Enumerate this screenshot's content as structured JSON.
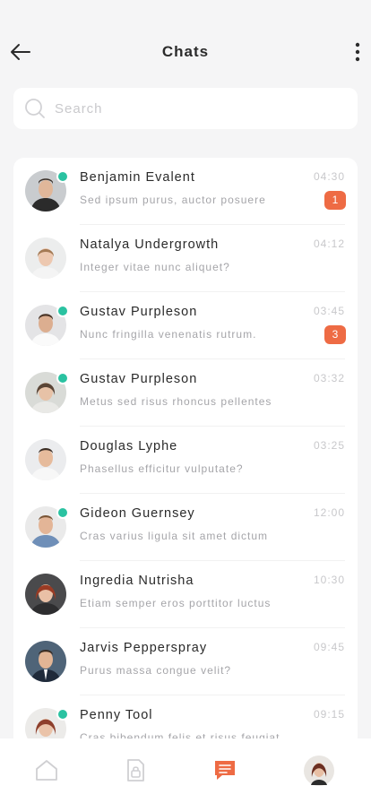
{
  "header": {
    "title": "Chats"
  },
  "search": {
    "placeholder": "Search"
  },
  "chats": [
    {
      "name": "Benjamin Evalent",
      "message": "Sed ipsum purus, auctor posuere",
      "time": "04:30",
      "unread": "1",
      "online": true
    },
    {
      "name": "Natalya Undergrowth",
      "message": "Integer vitae nunc aliquet?",
      "time": "04:12",
      "unread": "",
      "online": false
    },
    {
      "name": "Gustav Purpleson",
      "message": "Nunc fringilla venenatis rutrum.",
      "time": "03:45",
      "unread": "3",
      "online": true
    },
    {
      "name": "Gustav Purpleson",
      "message": "Metus sed risus rhoncus pellentes",
      "time": "03:32",
      "unread": "",
      "online": true
    },
    {
      "name": "Douglas Lyphe",
      "message": "Phasellus efficitur vulputate?",
      "time": "03:25",
      "unread": "",
      "online": false
    },
    {
      "name": "Gideon Guernsey",
      "message": "Cras varius ligula sit amet dictum",
      "time": "12:00",
      "unread": "",
      "online": true
    },
    {
      "name": "Ingredia Nutrisha",
      "message": "Etiam semper eros porttitor luctus",
      "time": "10:30",
      "unread": "",
      "online": false
    },
    {
      "name": "Jarvis Pepperspray",
      "message": "Purus massa congue velit?",
      "time": "09:45",
      "unread": "",
      "online": false
    },
    {
      "name": "Penny Tool",
      "message": "Cras bibendum felis et risus feugiat",
      "time": "09:15",
      "unread": "",
      "online": true
    }
  ],
  "colors": {
    "accent": "#ee6b44",
    "online": "#2ac2a1"
  },
  "tabbar": {
    "items": [
      "home-icon",
      "document-icon",
      "chat-icon",
      "profile-avatar"
    ],
    "active": "chat-icon"
  }
}
